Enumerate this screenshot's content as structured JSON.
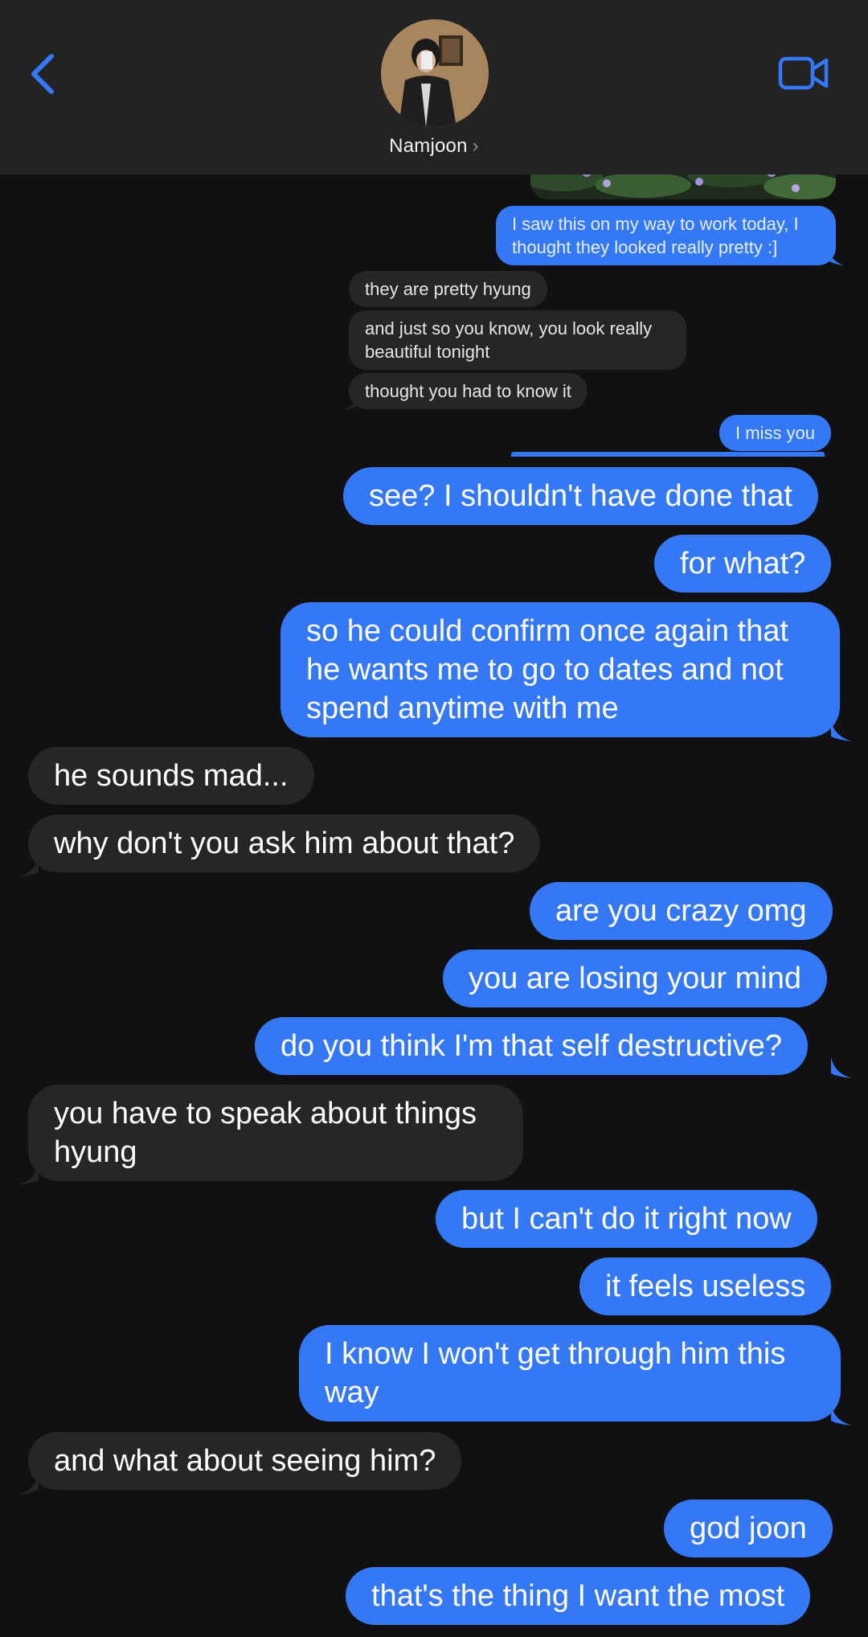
{
  "header": {
    "contact_name": "Namjoon",
    "chevron": "›",
    "back_icon": "chevron-left-icon",
    "video_icon": "video-camera-icon"
  },
  "colors": {
    "accent": "#3478f6",
    "incoming_bubble": "#262628",
    "background": "#111112",
    "header": "#232324"
  },
  "reply_thread": [
    {
      "dir": "out",
      "text": "I saw this on my way to work today, I thought they looked really pretty :]"
    },
    {
      "dir": "in",
      "text": "they are pretty hyung"
    },
    {
      "dir": "in",
      "text": "and just so you know, you look really beautiful tonight"
    },
    {
      "dir": "in",
      "text": "thought you had to know it"
    },
    {
      "dir": "out",
      "text": "I miss you"
    }
  ],
  "messages": [
    {
      "dir": "out",
      "text": "see? I shouldn't have done that"
    },
    {
      "dir": "out",
      "text": "for what?"
    },
    {
      "dir": "out",
      "text": "so he could confirm once again that he wants me to go to dates and not spend anytime with me"
    },
    {
      "dir": "in",
      "text": "he sounds mad..."
    },
    {
      "dir": "in",
      "text": "why don't you ask him about that?"
    },
    {
      "dir": "out",
      "text": "are you crazy omg"
    },
    {
      "dir": "out",
      "text": "you are losing your mind"
    },
    {
      "dir": "out",
      "text": "do you think I'm that self destructive?"
    },
    {
      "dir": "in",
      "text": "you have to speak about things hyung"
    },
    {
      "dir": "out",
      "text": "but I can't do it right now"
    },
    {
      "dir": "out",
      "text": "it feels useless"
    },
    {
      "dir": "out",
      "text": "I know I won't get through him this way"
    },
    {
      "dir": "in",
      "text": "and what about seeing him?"
    },
    {
      "dir": "out",
      "text": "god joon"
    },
    {
      "dir": "out",
      "text": "that's the thing I want the most"
    }
  ]
}
